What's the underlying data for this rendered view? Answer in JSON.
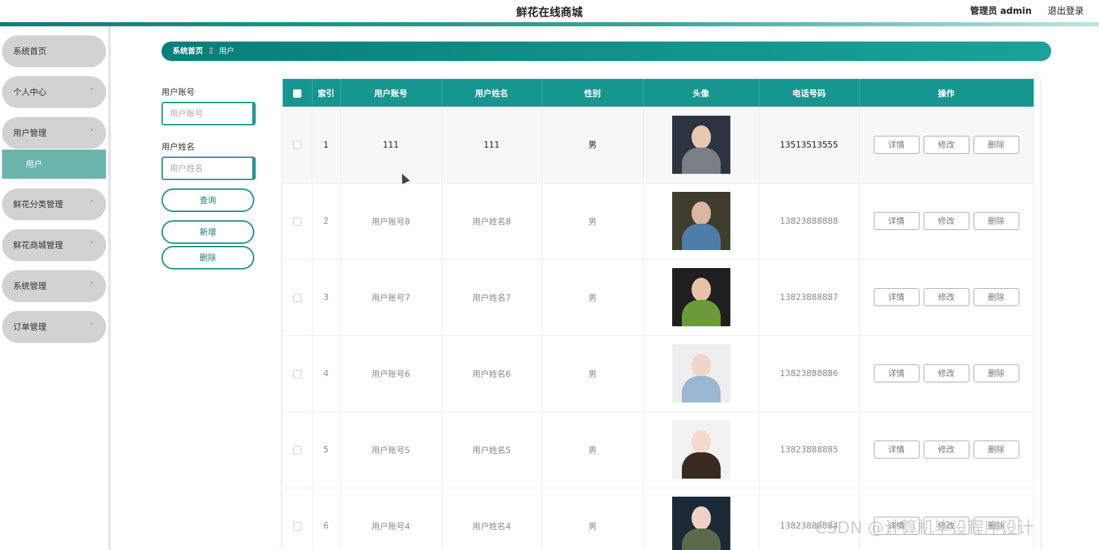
{
  "header": {
    "title": "鲜花在线商城",
    "admin": "管理员 admin",
    "logout": "退出登录"
  },
  "sidebar": {
    "items": [
      {
        "label": "系统首页",
        "chevron": ""
      },
      {
        "label": "个人中心",
        "chevron": "˅"
      },
      {
        "label": "用户管理",
        "chevron": "˄"
      },
      {
        "label": "鲜花分类管理",
        "chevron": "˅"
      },
      {
        "label": "鲜花商城管理",
        "chevron": "˅"
      },
      {
        "label": "系统管理",
        "chevron": "˅"
      },
      {
        "label": "订单管理",
        "chevron": "˅"
      }
    ],
    "sub_item": "用户"
  },
  "breadcrumb": {
    "home": "系统首页",
    "sep": "Ξ",
    "current": "用户"
  },
  "search": {
    "account_label": "用户账号",
    "account_placeholder": "用户账号",
    "name_label": "用户姓名",
    "name_placeholder": "用户姓名",
    "query_btn": "查询",
    "add_btn": "新增",
    "delete_btn": "删除"
  },
  "table": {
    "headers": [
      "索引",
      "用户账号",
      "用户姓名",
      "性别",
      "头像",
      "电话号码",
      "操作"
    ],
    "rows": [
      {
        "index": "1",
        "account": "111",
        "name": "111",
        "gender": "男",
        "phone": "13513513555",
        "avatar_colors": [
          "#2d3340",
          "#e8c9b0",
          "#7a7f86"
        ]
      },
      {
        "index": "2",
        "account": "用户账号8",
        "name": "用户姓名8",
        "gender": "男",
        "phone": "13823888888",
        "avatar_colors": [
          "#3e3d2e",
          "#d9b7a0",
          "#4e7da8"
        ]
      },
      {
        "index": "3",
        "account": "用户账号7",
        "name": "用户姓名7",
        "gender": "男",
        "phone": "13823888887",
        "avatar_colors": [
          "#1f1f1f",
          "#e5c2a8",
          "#6a9a3a"
        ]
      },
      {
        "index": "4",
        "account": "用户账号6",
        "name": "用户姓名6",
        "gender": "男",
        "phone": "13823888886",
        "avatar_colors": [
          "#eeeeee",
          "#f0d6c8",
          "#9bb7d0"
        ]
      },
      {
        "index": "5",
        "account": "用户账号5",
        "name": "用户姓名5",
        "gender": "男",
        "phone": "13823888885",
        "avatar_colors": [
          "#f2f2f2",
          "#f3dacd",
          "#3a2a24"
        ]
      },
      {
        "index": "6",
        "account": "用户账号4",
        "name": "用户姓名4",
        "gender": "男",
        "phone": "13823888884",
        "avatar_colors": [
          "#1b2a36",
          "#f0d2c4",
          "#5b6a4a"
        ]
      }
    ],
    "actions": {
      "detail": "详情",
      "edit": "修改",
      "delete": "删除"
    }
  },
  "watermark": "CSDN @计算机毕设程序设计",
  "colors": {
    "accent": "#17968f",
    "sidebar_bg": "#d2d2d2",
    "submenu_active": "#6ab4ac"
  }
}
